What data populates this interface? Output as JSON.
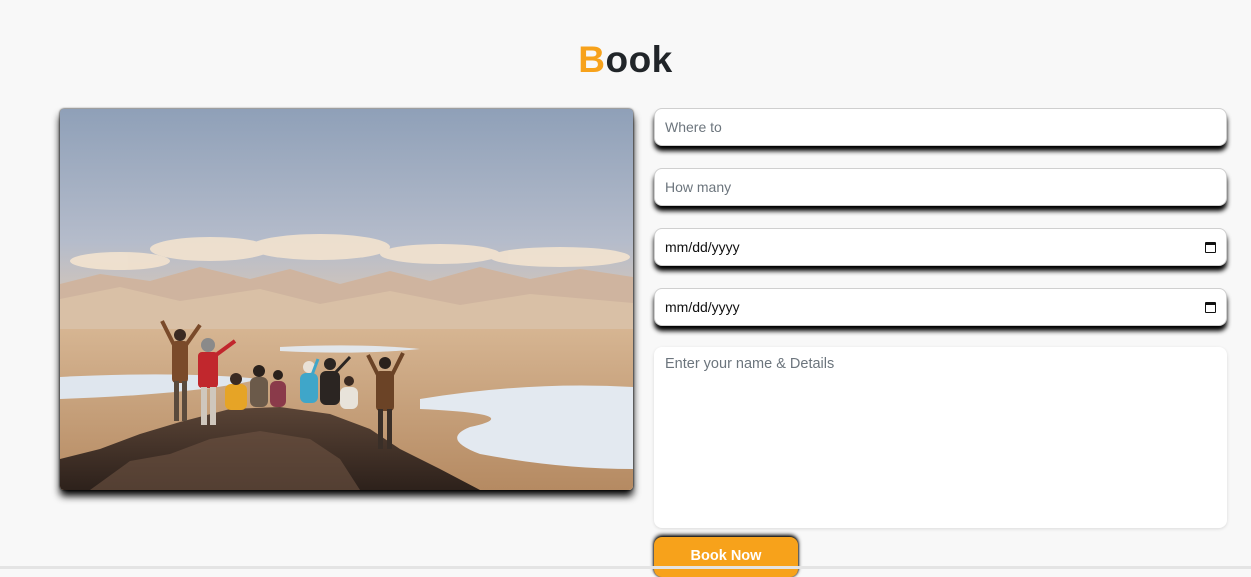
{
  "heading": {
    "accent_letter": "B",
    "rest": "ook"
  },
  "form": {
    "destination": {
      "placeholder": "Where to"
    },
    "guests": {
      "placeholder": "How many"
    },
    "arrival": {
      "value": "mm/dd/yyyy",
      "icon": "calendar-icon"
    },
    "departure": {
      "value": "mm/dd/yyyy",
      "icon": "calendar-icon"
    },
    "details": {
      "placeholder": "Enter your name & Details"
    },
    "submit_label": "Book Now"
  },
  "colors": {
    "accent": "#f7a21b",
    "page_background": "#f8f8f8",
    "heading_text": "#212529"
  }
}
